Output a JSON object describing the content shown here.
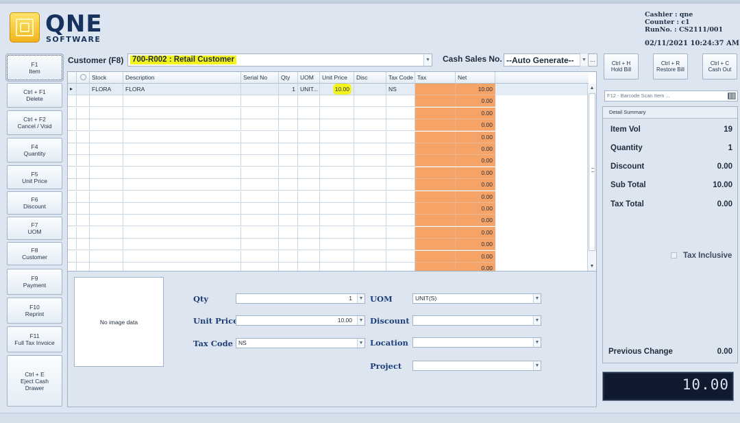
{
  "header": {
    "logo_word": "QNE",
    "logo_sub": "SOFTWARE",
    "cashier": "Cashier : qne",
    "counter": "Counter : c1",
    "run_no": "RunNo. : CS2111/001",
    "datetime": "02/11/2021 10:24:37 AM"
  },
  "fkeys": [
    {
      "key": "F1",
      "label": "Item"
    },
    {
      "key": "Ctrl + F1",
      "label": "Delete"
    },
    {
      "key": "Ctrl + F2",
      "label": "Cancel / Void"
    },
    {
      "key": "F4",
      "label": "Quantity"
    },
    {
      "key": "F5",
      "label": "Unit Price"
    },
    {
      "key": "F6",
      "label": "Discount"
    },
    {
      "key": "F7",
      "label": "UOM"
    },
    {
      "key": "F8",
      "label": "Customer"
    },
    {
      "key": "F9",
      "label": "Payment"
    },
    {
      "key": "F10",
      "label": "Reprint"
    },
    {
      "key": "F11",
      "label": "Full Tax Invoice"
    },
    {
      "key": "Ctrl + E",
      "label": "Eject Cash",
      "label2": "Drawer"
    }
  ],
  "customer": {
    "label": "Customer (F8)",
    "value": "700-R002 : Retail Customer",
    "cash_sales_label": "Cash Sales No.",
    "cash_sales_value": "--Auto Generate--",
    "ellipsis": "..."
  },
  "grid": {
    "columns": [
      "Stock",
      "Description",
      "Serial No",
      "Qty",
      "UOM",
      "Unit Price",
      "Disc",
      "Tax Code",
      "Tax",
      "Net"
    ],
    "row": {
      "stock": "FLORA",
      "description": "FLORA",
      "serial": "",
      "qty": "1",
      "uom": "UNIT...",
      "unit_price": "10.00",
      "disc": "",
      "tax_code": "NS",
      "tax": "",
      "net": "10.00"
    },
    "empty_net": "0.00"
  },
  "detail": {
    "no_image": "No image data",
    "qty_label": "Qty",
    "qty_value": "1",
    "unit_price_label": "Unit Price",
    "unit_price_value": "10.00",
    "tax_code_label": "Tax Code",
    "tax_code_value": "NS",
    "uom_label": "UOM",
    "uom_value": "UNIT(S)",
    "discount_label": "Discount",
    "discount_value": "",
    "location_label": "Location",
    "location_value": "",
    "project_label": "Project",
    "project_value": ""
  },
  "right": {
    "hold": {
      "key": "Ctrl + H",
      "label": "Hold Bill"
    },
    "restore": {
      "key": "Ctrl + R",
      "label": "Restore Bill"
    },
    "cashout": {
      "key": "Ctrl + C",
      "label": "Cash Out"
    },
    "barcode_placeholder": "F12 - Barcode Scan Item ...",
    "summary_title": "Detail Summary",
    "item_vol_label": "Item Vol",
    "item_vol": "19",
    "quantity_label": "Quantity",
    "quantity": "1",
    "discount_label": "Discount",
    "discount": "0.00",
    "subtotal_label": "Sub Total",
    "subtotal": "10.00",
    "taxtotal_label": "Tax Total",
    "taxtotal": "0.00",
    "tax_inclusive_label": "Tax Inclusive",
    "prev_change_label": "Previous Change",
    "prev_change": "0.00",
    "display_total": "10.00"
  },
  "colors": {
    "accent_highlight": "#f5f31e",
    "tax_net_column": "#f5a366",
    "display_bg": "#0f1a2e"
  }
}
